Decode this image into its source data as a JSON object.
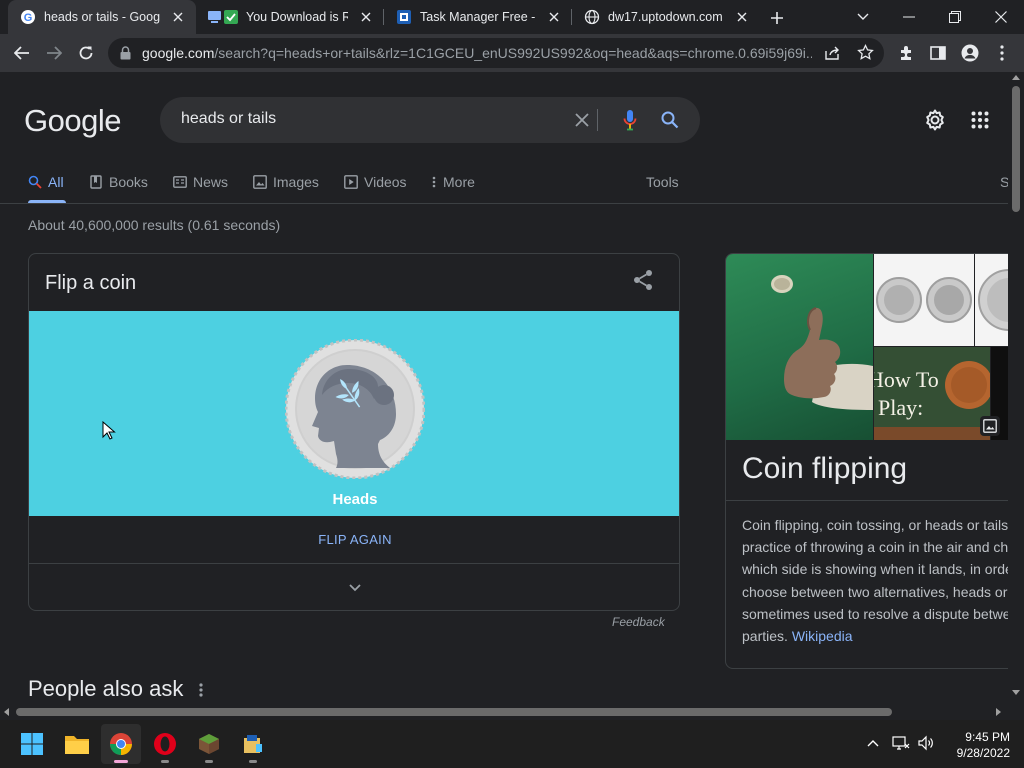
{
  "browser": {
    "tabs": [
      {
        "title": "heads or tails - Google",
        "active": true,
        "icon": "google-icon"
      },
      {
        "title": "You Download is Re",
        "active": false,
        "icon": "download-check-icon"
      },
      {
        "title": "Task Manager Free - M",
        "active": false,
        "icon": "task-manager-icon"
      },
      {
        "title": "dw17.uptodown.com",
        "active": false,
        "icon": "globe-icon"
      }
    ],
    "url_host": "google.com",
    "url_rest": "/search?q=heads+or+tails&rlz=1C1GCEU_enUS992US992&oq=head&aqs=chrome.0.69i59j69i..."
  },
  "google": {
    "logo": "Google",
    "query": "heads or tails",
    "nav": [
      {
        "label": "All",
        "icon": "search-icon",
        "active": true
      },
      {
        "label": "Books",
        "icon": "book-icon",
        "active": false
      },
      {
        "label": "News",
        "icon": "news-icon",
        "active": false
      },
      {
        "label": "Images",
        "icon": "image-icon",
        "active": false
      },
      {
        "label": "Videos",
        "icon": "play-icon",
        "active": false
      },
      {
        "label": "More",
        "icon": "more-vert-icon",
        "active": false
      }
    ],
    "tools_label": "Tools",
    "nav_cut_label": "S",
    "result_stats": "About 40,600,000 results (0.61 seconds)"
  },
  "coin_widget": {
    "title": "Flip a coin",
    "result_label": "Heads",
    "flip_again": "FLIP AGAIN",
    "feedback": "Feedback",
    "stage_color": "#4dd0e1"
  },
  "people_also_ask": "People also ask",
  "knowledge_panel": {
    "title": "Coin flipping",
    "description_lines": [
      "Coin flipping, coin tossing, or heads or tails",
      "practice of throwing a coin in the air and ch",
      "which side is showing when it lands, in orde",
      "choose between two alternatives, heads or",
      "sometimes used to resolve a dispute betwe",
      "parties."
    ],
    "source_link": "Wikipedia",
    "image_text": "How To Play:"
  },
  "taskbar": {
    "apps": [
      "start-icon",
      "file-explorer-icon",
      "chrome-icon",
      "opera-icon",
      "minecraft-icon",
      "app-installer-icon"
    ],
    "time": "9:45 PM",
    "date": "9/28/2022"
  },
  "colors": {
    "accent_blue": "#8ab4f8",
    "page_bg": "#202124",
    "coin_stage": "#4dd0e1"
  }
}
